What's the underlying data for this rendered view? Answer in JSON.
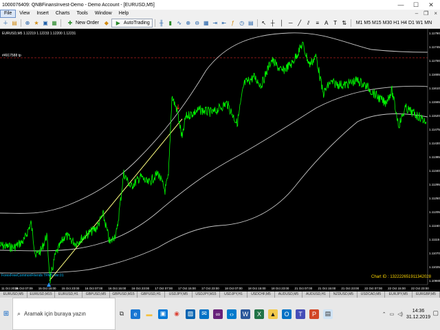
{
  "window": {
    "title": "1000076409: QNBFinansInvest-Demo - Demo Account - [EURUSD,M5]",
    "minimize": "—",
    "maximize": "☐",
    "close": "✕"
  },
  "menu": {
    "items": [
      "File",
      "View",
      "Insert",
      "Charts",
      "Tools",
      "Window",
      "Help"
    ],
    "active": "File"
  },
  "toolbar": {
    "new_order_label": "New Order",
    "autotrading_label": "AutoTrading",
    "icons": [
      "new-chart-icon",
      "profiles-icon",
      "zoom-icon",
      "navigator-icon",
      "terminal-icon",
      "new-order-icon",
      "autotrading-icon",
      "bar-chart-icon",
      "candles-icon",
      "line-chart-icon",
      "zoom-in-icon",
      "zoom-out-icon",
      "tile-icon",
      "autoscroll-icon",
      "shift-icon",
      "indicators-icon",
      "periods-icon",
      "templates-icon",
      "cursor-icon",
      "crosshair-icon",
      "vline-icon",
      "hline-icon",
      "trendline-icon",
      "channel-icon",
      "fibo-icon",
      "text-icon",
      "label-icon",
      "arrows-icon"
    ]
  },
  "chart": {
    "symbol_line": "EURUSD,M5  1.12219 1.12233 1.12200 1.12231",
    "order_line_label": "#4917588 tp",
    "indicator_label": "ForexFreeCommonFriends TFMS Ver.01",
    "chart_id": "Chart ID : 132222651911342028",
    "x_labels": [
      "11 Oct 2019",
      "15 Oct 07:09",
      "15 Oct 15:00",
      "15 Oct 23:00",
      "16 Oct 07:00",
      "16 Oct 15:00",
      "16 Oct 23:00",
      "17 Oct 07:00",
      "17 Oct 15:00",
      "17 Oct 23:00",
      "18 Oct 07:00",
      "18 Oct 15:00",
      "18 Oct 23:00",
      "21 Oct 07:00",
      "21 Oct 15:00",
      "21 Oct 23:00",
      "22 Oct 07:00",
      "22 Oct 15:00",
      "22 Oct 23:00"
    ],
    "y_labels": [
      "1.11790",
      "1.11745",
      "1.11700",
      "1.11655",
      "1.11610",
      "1.11565",
      "1.11520",
      "1.11475",
      "1.11430",
      "1.11385",
      "1.11340",
      "1.11295",
      "1.11250",
      "1.11205",
      "1.11160",
      "1.11115",
      "1.11070",
      "1.11025",
      "1.10980"
    ],
    "colors": {
      "price": "#00ff00",
      "bands": "#c8c8c8",
      "trendline": "#ffff80",
      "order_line": "#b22222",
      "chart_id": "#ffd700",
      "indicator": "#00bfff",
      "sell_arrow": "#ff2020",
      "buy_arrow": "#1e90ff"
    }
  },
  "tabs": [
    "EURUSD,M5",
    "EURUSD,M15",
    "EURUSD,H1",
    "GBPUSD,M5",
    "GBPUSD,M15",
    "GBPUSD,H1",
    "USDJPY,M5",
    "USDJPY,M15",
    "USDJPY,H1",
    "USDCHF,M5",
    "AUDUSD,M5",
    "AUDUSD,H1",
    "NZDUSD,M5",
    "USDCAD,M5",
    "EURJPY,M5",
    "EURGBP,M5"
  ],
  "taskbar": {
    "search_placeholder": "Aramak için buraya yazın",
    "time": "14:36",
    "date": "31.12.2019",
    "apps": [
      "task-view-icon",
      "edge-icon",
      "file-explorer-icon",
      "store-icon",
      "chrome-icon",
      "photos-icon",
      "mail-icon",
      "visual-studio-icon",
      "code-icon",
      "word-icon",
      "excel-icon",
      "metatrader-icon",
      "outlook-icon",
      "teams-icon",
      "powerpoint-icon",
      "notepad-icon"
    ]
  }
}
